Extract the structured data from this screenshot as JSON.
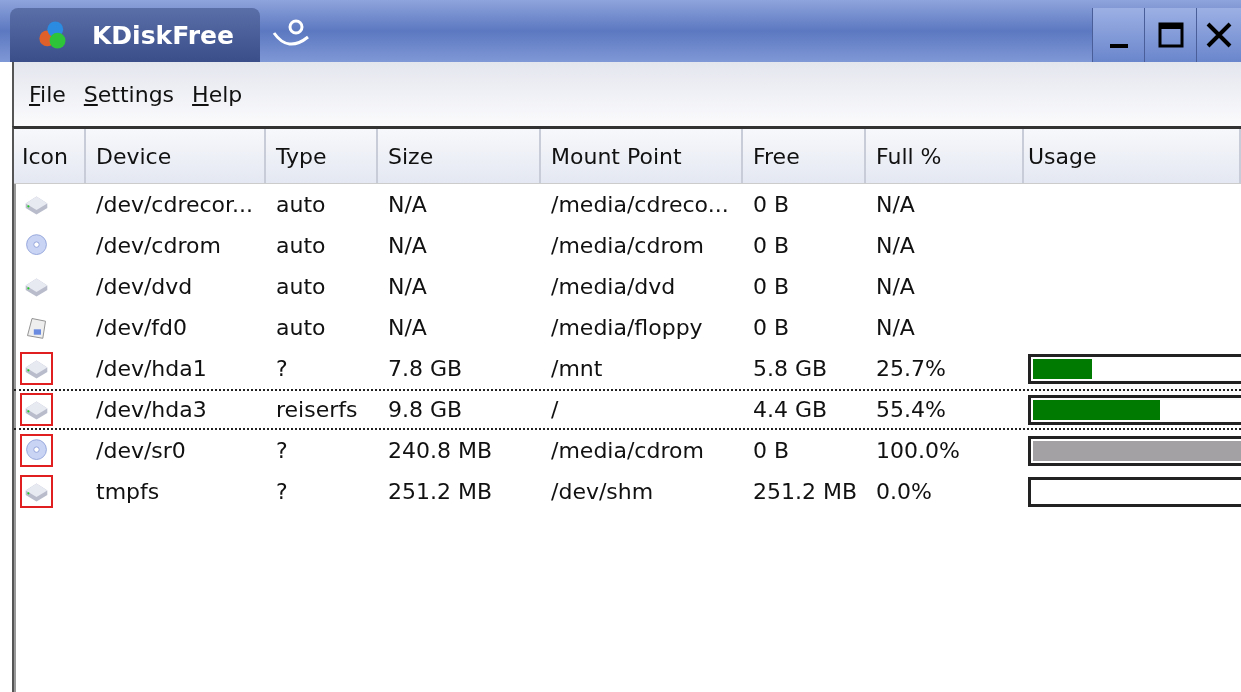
{
  "window": {
    "title": "KDiskFree"
  },
  "menu": [
    {
      "label": "File"
    },
    {
      "label": "Settings"
    },
    {
      "label": "Help"
    }
  ],
  "columns": [
    "Icon",
    "Device",
    "Type",
    "Size",
    "Mount Point",
    "Free",
    "Full %",
    "Usage"
  ],
  "rows": [
    {
      "kind": "drive",
      "mounted": false,
      "focused": false,
      "device": "/dev/cdrecor...",
      "type": "auto",
      "size": "N/A",
      "mount": "/media/cdreco...",
      "free": "0 B",
      "full": "N/A",
      "usage_bar": false
    },
    {
      "kind": "disc",
      "mounted": false,
      "focused": false,
      "device": "/dev/cdrom",
      "type": "auto",
      "size": "N/A",
      "mount": "/media/cdrom",
      "free": "0 B",
      "full": "N/A",
      "usage_bar": false
    },
    {
      "kind": "drive",
      "mounted": false,
      "focused": false,
      "device": "/dev/dvd",
      "type": "auto",
      "size": "N/A",
      "mount": "/media/dvd",
      "free": "0 B",
      "full": "N/A",
      "usage_bar": false
    },
    {
      "kind": "floppy",
      "mounted": false,
      "focused": false,
      "device": "/dev/fd0",
      "type": "auto",
      "size": "N/A",
      "mount": "/media/floppy",
      "free": "0 B",
      "full": "N/A",
      "usage_bar": false
    },
    {
      "kind": "drive",
      "mounted": true,
      "focused": false,
      "device": "/dev/hda1",
      "type": "?",
      "size": "7.8 GB",
      "mount": "/mnt",
      "free": "5.8 GB",
      "full": "25.7%",
      "usage_bar": true,
      "usage": {
        "level": 0.257,
        "color": "#007a00"
      }
    },
    {
      "kind": "drive",
      "mounted": true,
      "focused": true,
      "device": "/dev/hda3",
      "type": "reiserfs",
      "size": "9.8 GB",
      "mount": "/",
      "free": "4.4 GB",
      "full": "55.4%",
      "usage_bar": true,
      "usage": {
        "level": 0.554,
        "color": "#007a00"
      }
    },
    {
      "kind": "disc",
      "mounted": true,
      "focused": false,
      "device": "/dev/sr0",
      "type": "?",
      "size": "240.8 MB",
      "mount": "/media/cdrom",
      "free": "0 B",
      "full": "100.0%",
      "usage_bar": true,
      "usage": {
        "level": 1,
        "color": "#a3a1a4"
      }
    },
    {
      "kind": "drive",
      "mounted": true,
      "focused": false,
      "device": "tmpfs",
      "type": "?",
      "size": "251.2 MB",
      "mount": "/dev/shm",
      "free": "251.2 MB",
      "full": "0.0%",
      "usage_bar": true
    }
  ]
}
